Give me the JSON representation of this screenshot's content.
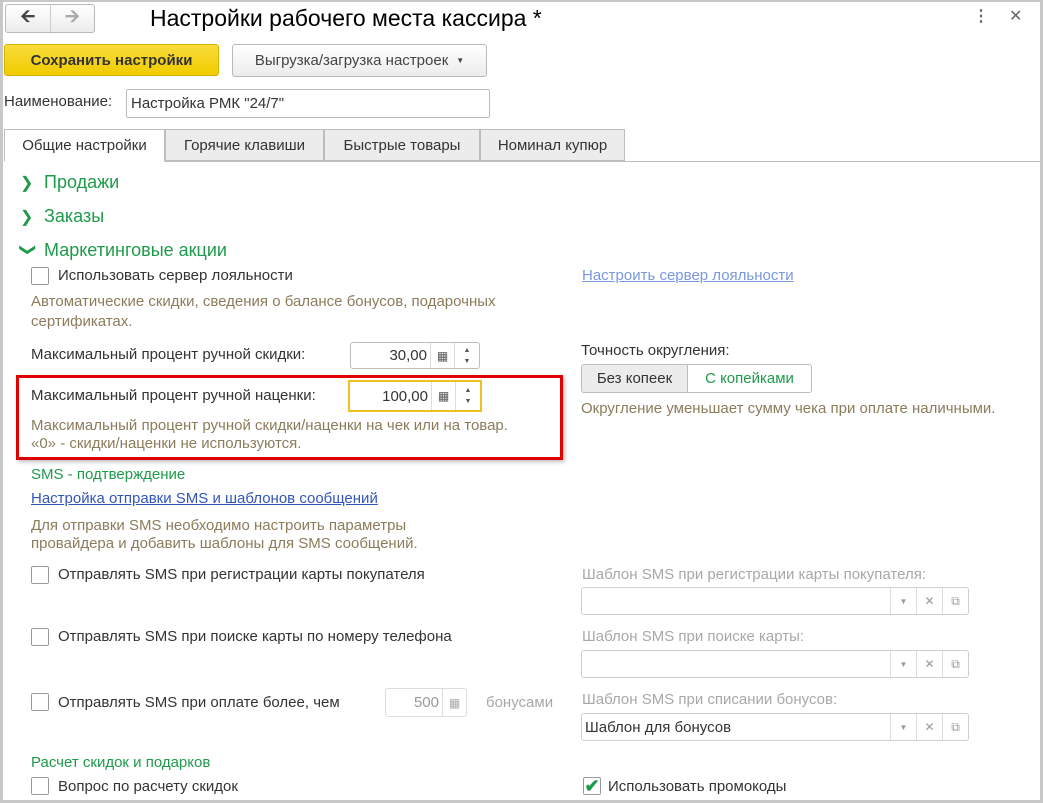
{
  "window": {
    "title": "Настройки рабочего места кассира *",
    "back_icon": "arrow-left-icon",
    "forward_icon": "arrow-right-icon",
    "more_icon": "more-vertical-icon",
    "close_icon": "close-icon"
  },
  "toolbar": {
    "save_label": "Сохранить настройки",
    "export_label": "Выгрузка/загрузка настроек"
  },
  "name_field": {
    "label": "Наименование:",
    "value": "Настройка РМК \"24/7\""
  },
  "tabs": [
    {
      "label": "Общие настройки",
      "active": true
    },
    {
      "label": "Горячие клавиши"
    },
    {
      "label": "Быстрые товары"
    },
    {
      "label": "Номинал купюр"
    }
  ],
  "sections": {
    "sales": "Продажи",
    "orders": "Заказы",
    "marketing": "Маркетинговые акции"
  },
  "marketing": {
    "loyalty_checkbox": {
      "label": "Использовать сервер лояльности",
      "checked": false
    },
    "loyalty_link": "Настроить сервер лояльности",
    "loyalty_hint": "Автоматические скидки, сведения о балансе бонусов, подарочных сертификатах.",
    "max_discount": {
      "label": "Максимальный процент ручной скидки:",
      "value": "30,00"
    },
    "max_markup": {
      "label": "Максимальный процент ручной наценки:",
      "value": "100,00"
    },
    "markup_hint_1": "Максимальный процент ручной скидки/наценки на чек или на товар.",
    "markup_hint_2": "«0» - скидки/наценки не используются.",
    "rounding": {
      "label": "Точность округления:",
      "options": [
        "Без копеек",
        "С копейками"
      ],
      "selected": "С копейками",
      "hint": "Округление уменьшает сумму чека при оплате наличными."
    },
    "sms_title": "SMS - подтверждение",
    "sms_link": "Настройка отправки SMS и шаблонов сообщений",
    "sms_hint_1": "Для отправки SMS необходимо настроить параметры",
    "sms_hint_2": "провайдера и добавить шаблоны для SMS сообщений.",
    "sms_register": {
      "label": "Отправлять SMS при регистрации карты покупателя",
      "checked": false,
      "template_label": "Шаблон SMS при регистрации карты покупателя:",
      "template_value": ""
    },
    "sms_search": {
      "label": "Отправлять SMS при поиске карты по номеру телефона",
      "checked": false,
      "template_label": "Шаблон SMS при поиске карты:",
      "template_value": ""
    },
    "sms_payment": {
      "label": "Отправлять SMS при оплате более, чем",
      "checked": false,
      "amount": "500",
      "unit": "бонусами",
      "template_label": "Шаблон SMS при списании бонусов:",
      "template_value": "Шаблон для бонусов"
    },
    "calc_title": "Расчет скидок и подарков",
    "calc_question": {
      "label": "Вопрос по расчету скидок",
      "checked": false
    },
    "promocodes": {
      "label": "Использовать промокоды",
      "checked": true
    }
  },
  "colors": {
    "accent_green": "#1e9b4a",
    "save_yellow": "#f0cc00",
    "highlight_red": "#e00000",
    "focus_yellow": "#f0c020"
  }
}
